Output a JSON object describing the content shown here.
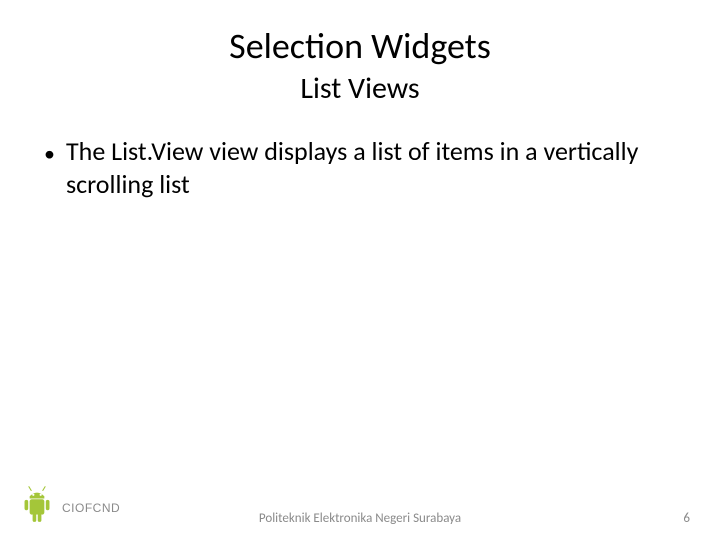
{
  "title": "Selection Widgets",
  "subtitle": "List Views",
  "bullets": [
    "The List.View view displays a list of items in a vertically scrolling list"
  ],
  "footer": "Politeknik Elektronika Negeri Surabaya",
  "page_number": "6",
  "logo": {
    "word": "CIOFCND",
    "color": "#A4C639"
  }
}
